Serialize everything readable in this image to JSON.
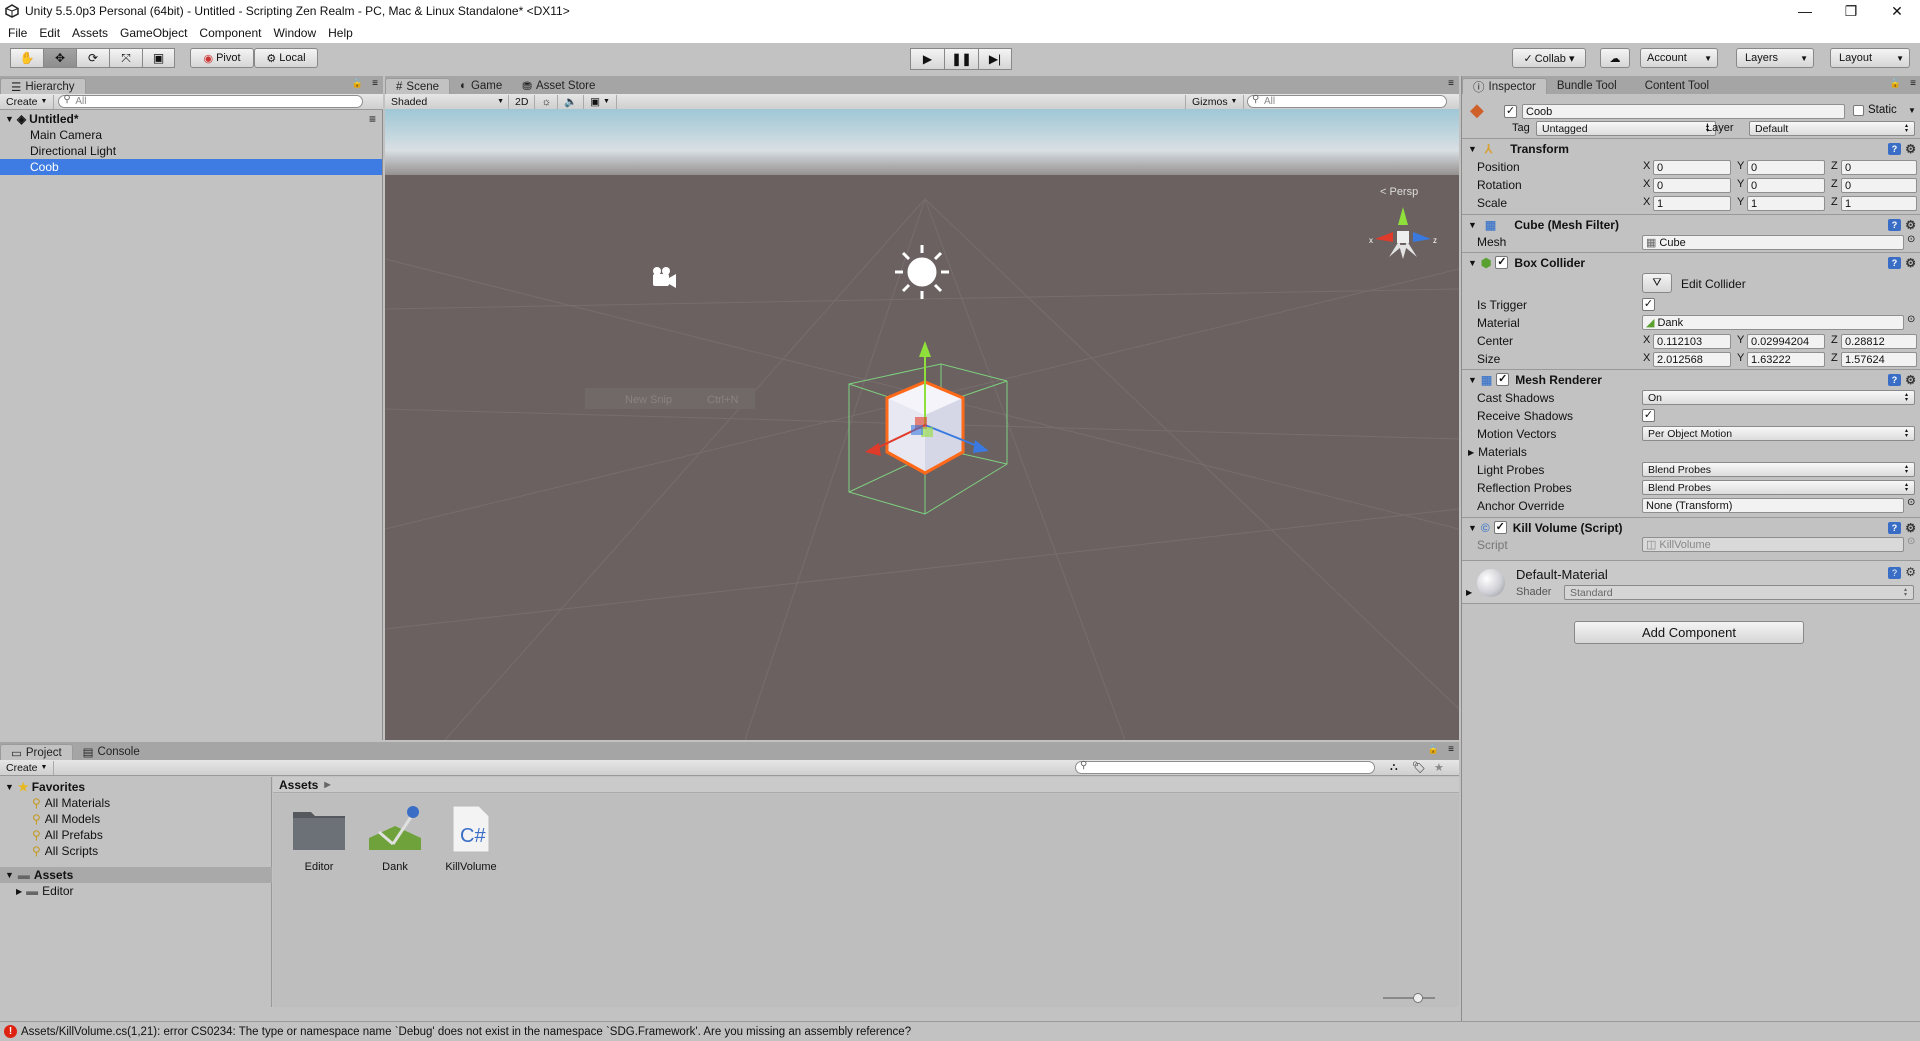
{
  "window": {
    "title": "Unity 5.5.0p3 Personal (64bit) - Untitled - Scripting Zen Realm - PC, Mac & Linux Standalone* <DX11>",
    "controls": [
      "—",
      "❐",
      "✕"
    ]
  },
  "menu": [
    "File",
    "Edit",
    "Assets",
    "GameObject",
    "Component",
    "Window",
    "Help"
  ],
  "toolbar": {
    "pivot_label": "Pivot",
    "local_label": "Local",
    "collab_label": "Collab ▾",
    "account_label": "Account",
    "layers_label": "Layers",
    "layout_label": "Layout"
  },
  "hierarchy": {
    "tab": "Hierarchy",
    "create": "Create",
    "search_placeholder": "All",
    "scene_name": "Untitled*",
    "items": [
      "Main Camera",
      "Directional Light",
      "Coob"
    ],
    "selected": "Coob"
  },
  "scene": {
    "tabs": [
      "Scene",
      "Game",
      "Asset Store"
    ],
    "active_tab": "Scene",
    "shading": "Shaded",
    "mode_2d": "2D",
    "gizmos": "Gizmos",
    "search_placeholder": "All",
    "persp_label": "Persp",
    "context_hint": "New Snip",
    "context_shortcut": "Ctrl+N"
  },
  "inspector": {
    "tabs": [
      "Inspector",
      "Bundle Tool",
      "Content Tool"
    ],
    "object_name": "Coob",
    "static_label": "Static",
    "tag_label": "Tag",
    "tag_value": "Untagged",
    "layer_label": "Layer",
    "layer_value": "Default",
    "transform": {
      "title": "Transform",
      "position_label": "Position",
      "rotation_label": "Rotation",
      "scale_label": "Scale",
      "position": [
        "0",
        "0",
        "0"
      ],
      "rotation": [
        "0",
        "0",
        "0"
      ],
      "scale": [
        "1",
        "1",
        "1"
      ]
    },
    "mesh_filter": {
      "title": "Cube (Mesh Filter)",
      "mesh_label": "Mesh",
      "mesh_value": "Cube"
    },
    "box_collider": {
      "title": "Box Collider",
      "edit_label": "Edit Collider",
      "is_trigger_label": "Is Trigger",
      "material_label": "Material",
      "material_value": "Dank",
      "center_label": "Center",
      "size_label": "Size",
      "center": [
        "0.112103",
        "0.02994204",
        "0.28812"
      ],
      "size": [
        "2.012568",
        "1.63222",
        "1.57624"
      ]
    },
    "mesh_renderer": {
      "title": "Mesh Renderer",
      "cast_shadows_label": "Cast Shadows",
      "cast_shadows": "On",
      "receive_shadows_label": "Receive Shadows",
      "motion_vectors_label": "Motion Vectors",
      "motion_vectors": "Per Object Motion",
      "materials_label": "Materials",
      "light_probes_label": "Light Probes",
      "light_probes": "Blend Probes",
      "reflection_probes_label": "Reflection Probes",
      "reflection_probes": "Blend Probes",
      "anchor_label": "Anchor Override",
      "anchor_value": "None (Transform)"
    },
    "kill_volume": {
      "title": "Kill Volume (Script)",
      "script_label": "Script",
      "script_value": "KillVolume"
    },
    "material": {
      "name": "Default-Material",
      "shader_label": "Shader",
      "shader_value": "Standard"
    },
    "add_component": "Add Component"
  },
  "project": {
    "tabs": [
      "Project",
      "Console"
    ],
    "create": "Create",
    "favorites_label": "Favorites",
    "favorites": [
      "All Materials",
      "All Models",
      "All Prefabs",
      "All Scripts"
    ],
    "assets_label": "Assets",
    "asset_folders": [
      "Editor"
    ],
    "breadcrumb": "Assets",
    "assets": [
      {
        "name": "Editor",
        "icon": "folder-icon"
      },
      {
        "name": "Dank",
        "icon": "physic-material-icon"
      },
      {
        "name": "KillVolume",
        "icon": "csharp-script-icon"
      }
    ]
  },
  "status": {
    "error": "Assets/KillVolume.cs(1,21): error CS0234: The type or namespace name `Debug' does not exist in the namespace `SDG.Framework'. Are you missing an assembly reference?"
  }
}
